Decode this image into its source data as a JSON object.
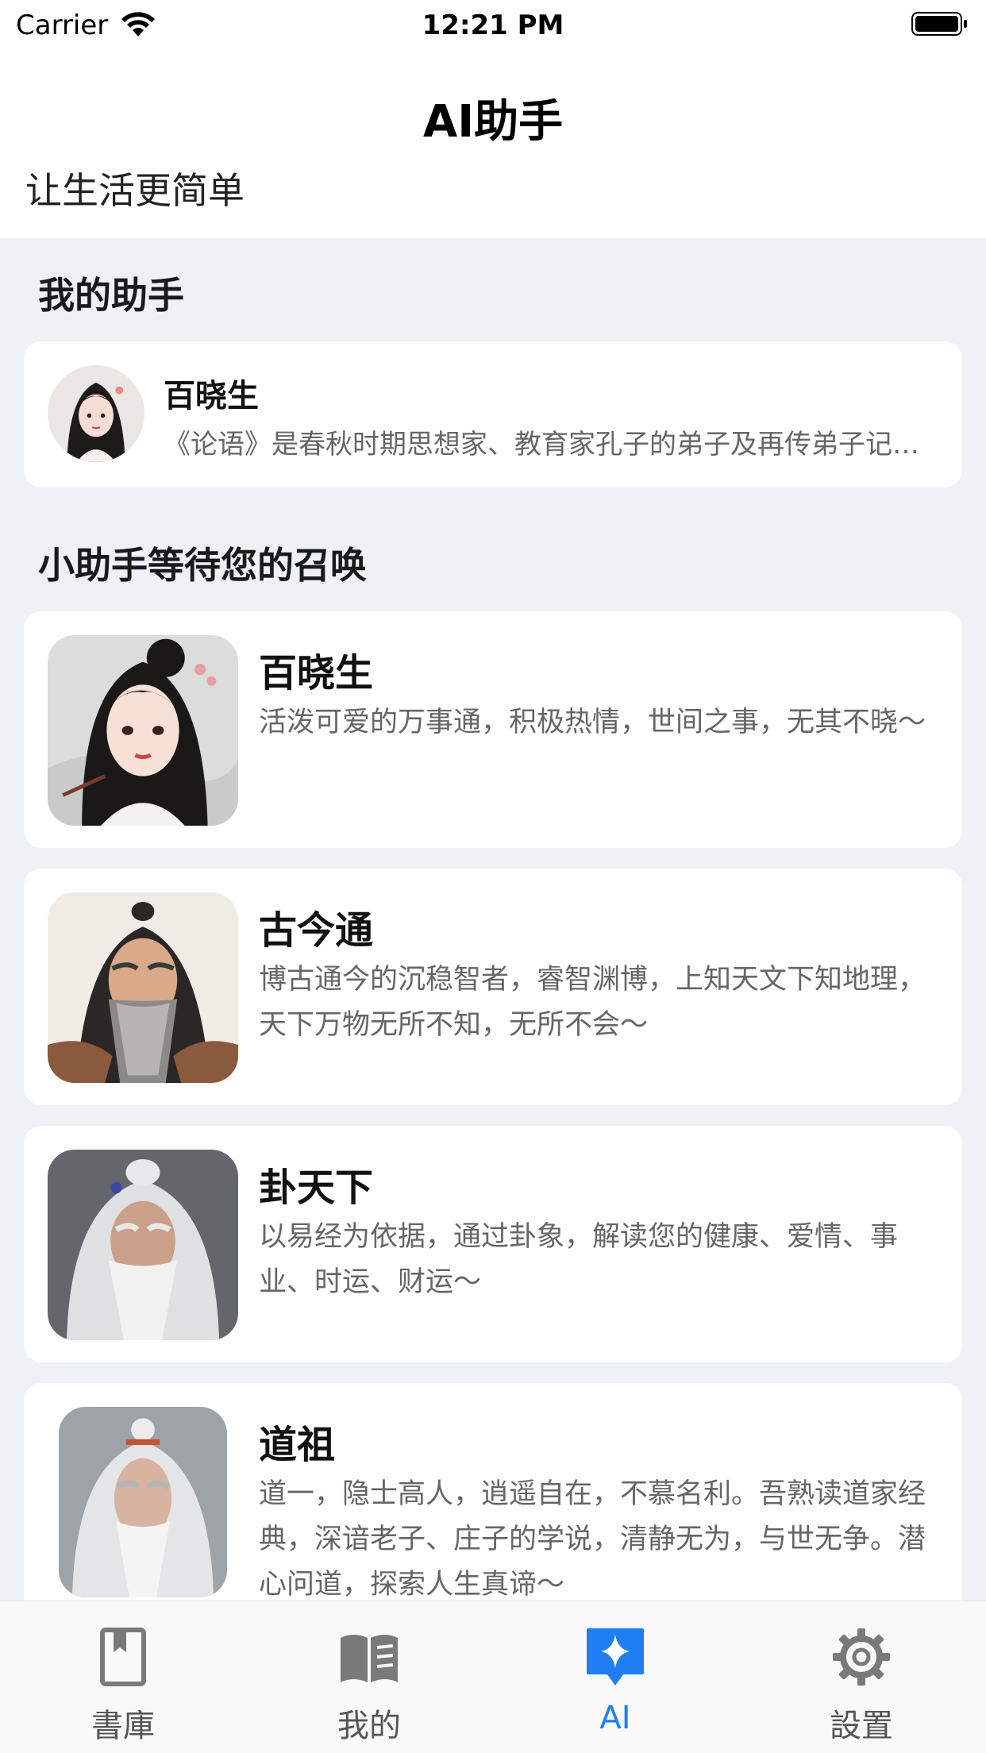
{
  "status_bar": {
    "carrier": "Carrier",
    "time": "12:21 PM"
  },
  "header": {
    "title": "AI助手",
    "subtitle": "让生活更简单"
  },
  "sections": {
    "my_assistant": "我的助手",
    "waiting": "小助手等待您的召唤"
  },
  "my_assistant": {
    "name": "百晓生",
    "desc": "《论语》是春秋时期思想家、教育家孔子的弟子及再传弟子记录孔子及其弟子言行而编成的语录文集"
  },
  "assistants": [
    {
      "name": "百晓生",
      "desc": "活泼可爱的万事通，积极热情，世间之事，无其不晓～"
    },
    {
      "name": "古今通",
      "desc": "博古通今的沉稳智者，睿智渊博，上知天文下知地理，天下万物无所不知，无所不会～"
    },
    {
      "name": "卦天下",
      "desc": "以易经为依据，通过卦象，解读您的健康、爱情、事业、时运、财运～"
    },
    {
      "name": "道祖",
      "desc": "道一，隐士高人，逍遥自在，不慕名利。吾熟读道家经典，深谙老子、庄子的学说，清静无为，与世无争。潜心问道，探索人生真谛～"
    }
  ],
  "tabs": [
    {
      "label": "書庫",
      "icon": "book-icon"
    },
    {
      "label": "我的",
      "icon": "open-book-icon"
    },
    {
      "label": "AI",
      "icon": "ai-sparkle-icon",
      "active": true
    },
    {
      "label": "設置",
      "icon": "gear-icon"
    }
  ],
  "colors": {
    "accent": "#1e7ef2",
    "background": "#eef1f6",
    "card": "#ffffff"
  }
}
